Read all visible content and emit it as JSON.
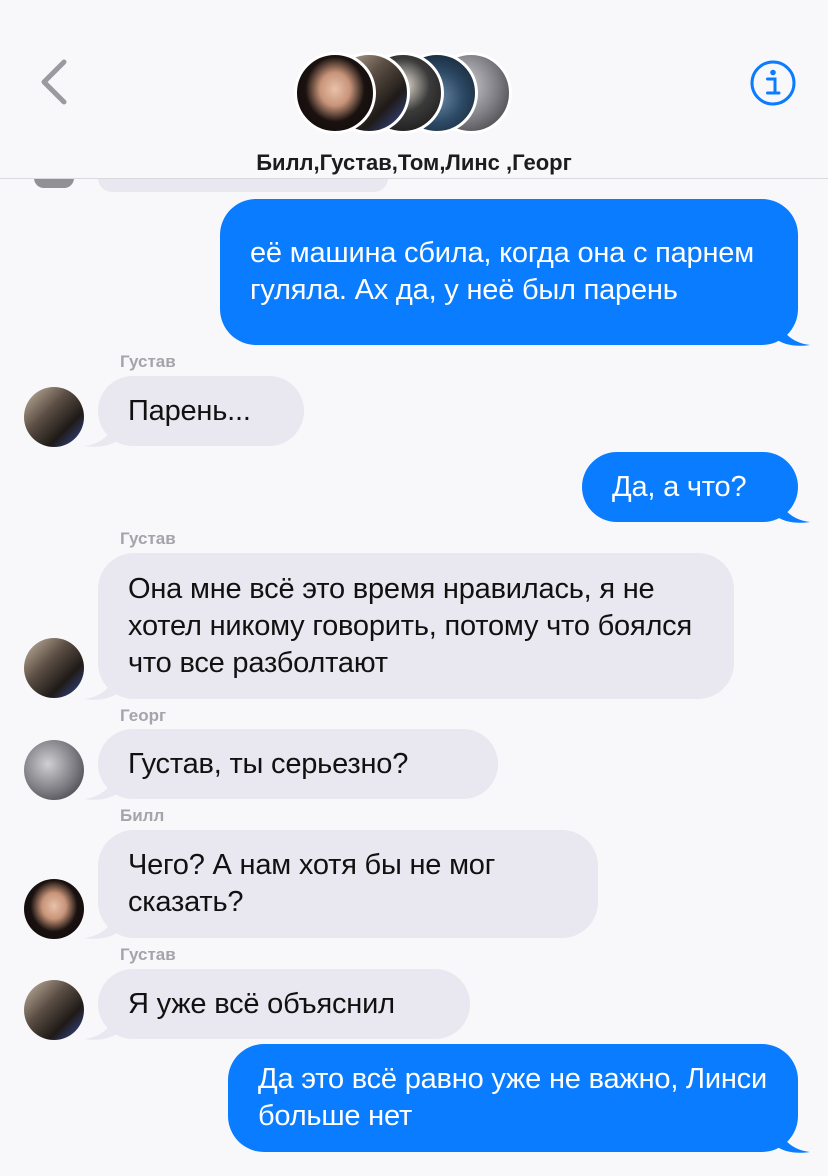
{
  "header": {
    "group_title": "Билл,Густав,Том,Линс ,Георг",
    "back_icon": "chevron-left-icon",
    "info_icon": "info-icon",
    "accent_color": "#0a7cff"
  },
  "messages": [
    {
      "direction": "outgoing",
      "text": "её машина сбила, когда она с парнем гуляла. Ах да, у неё был парень"
    },
    {
      "direction": "incoming",
      "sender": "Густав",
      "text": "Парень..."
    },
    {
      "direction": "outgoing",
      "text": "Да, а что?"
    },
    {
      "direction": "incoming",
      "sender": "Густав",
      "text": "Она мне всё это время нравилась, я не хотел никому говорить, потому что боялся что все разболтают"
    },
    {
      "direction": "incoming",
      "sender": "Георг",
      "text": "Густав, ты серьезно?"
    },
    {
      "direction": "incoming",
      "sender": "Билл",
      "text": "Чего? А нам хотя бы не мог сказать?"
    },
    {
      "direction": "incoming",
      "sender": "Густав",
      "text": "Я уже всё объяснил"
    },
    {
      "direction": "outgoing",
      "text": "Да это всё равно уже не важно, Линси больше нет"
    }
  ],
  "colors": {
    "outgoing_bubble": "#0a7cff",
    "incoming_bubble": "#e9e7ef",
    "background": "#f8f8fb",
    "sender_label": "#a4a4aa"
  }
}
